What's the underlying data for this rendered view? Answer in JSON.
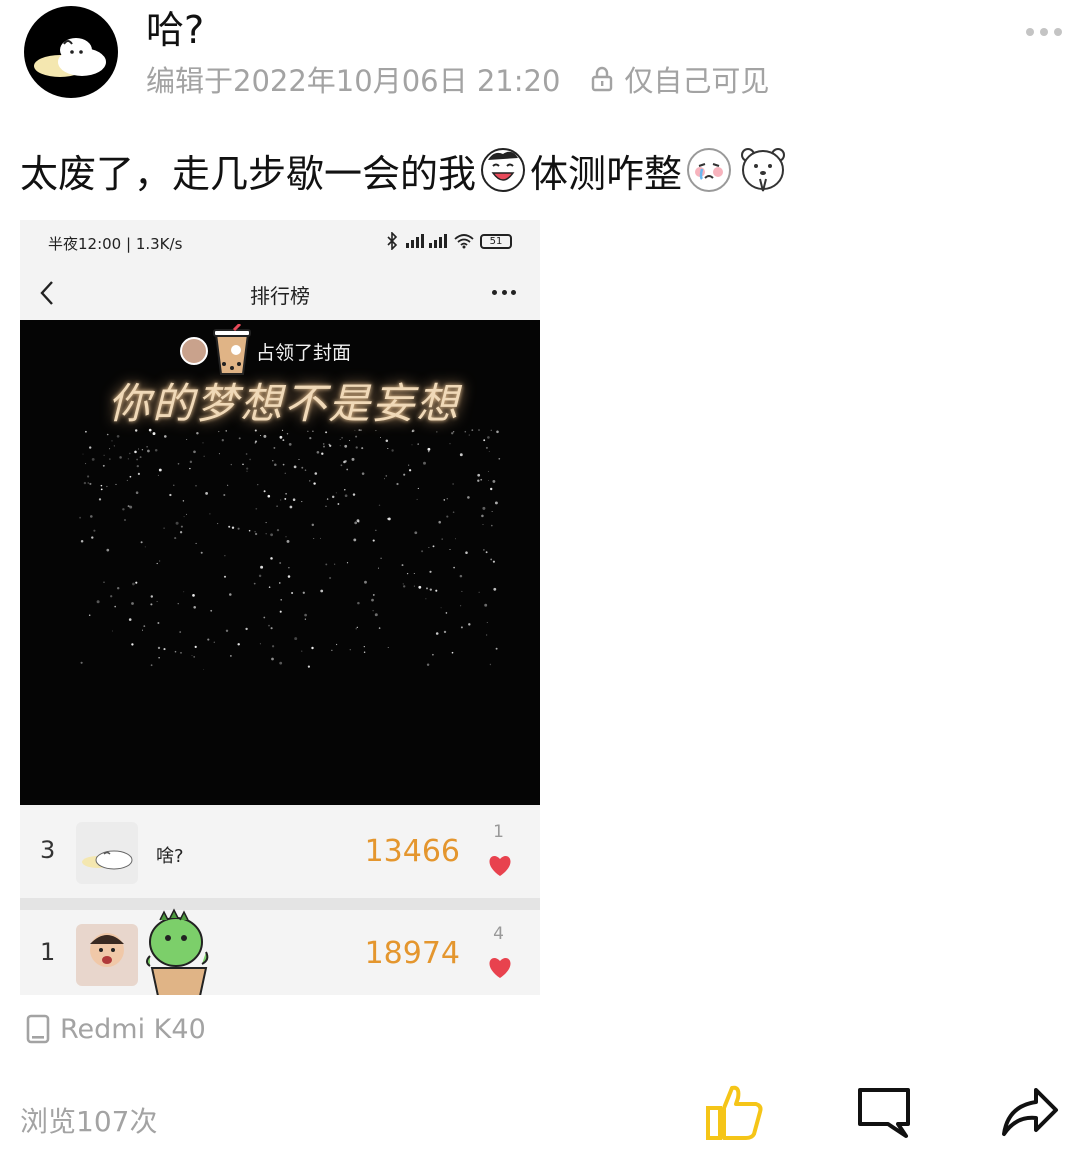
{
  "post": {
    "author_name": "哈?",
    "edited_time": "编辑于2022年10月06日 21:20",
    "visibility": "仅自己可见",
    "text_1": "太废了，走几步歇一会的我",
    "text_2": "体测咋整",
    "device": "Redmi K40",
    "views": "浏览107次"
  },
  "screenshot": {
    "status_time": "半夜12:00 | 1.3K/s",
    "battery": "51",
    "page_title": "排行榜",
    "cover_caption": "占领了封面",
    "cover_slogan": "你的梦想不是妄想",
    "ranking": [
      {
        "rank": "3",
        "name": "啥?",
        "score": "13466",
        "likes": "1"
      },
      {
        "rank": "1",
        "name": "",
        "score": "18974",
        "likes": "4"
      }
    ]
  },
  "icons": {
    "lock": "lock-icon",
    "more": "more-dots-icon",
    "device": "phone-icon",
    "like": "thumbs-up-icon",
    "comment": "comment-icon",
    "share": "share-icon"
  },
  "colors": {
    "like_accent": "#f5c518",
    "score": "#e4962e",
    "heart": "#e8424e",
    "meta_gray": "#a3a3a3"
  }
}
